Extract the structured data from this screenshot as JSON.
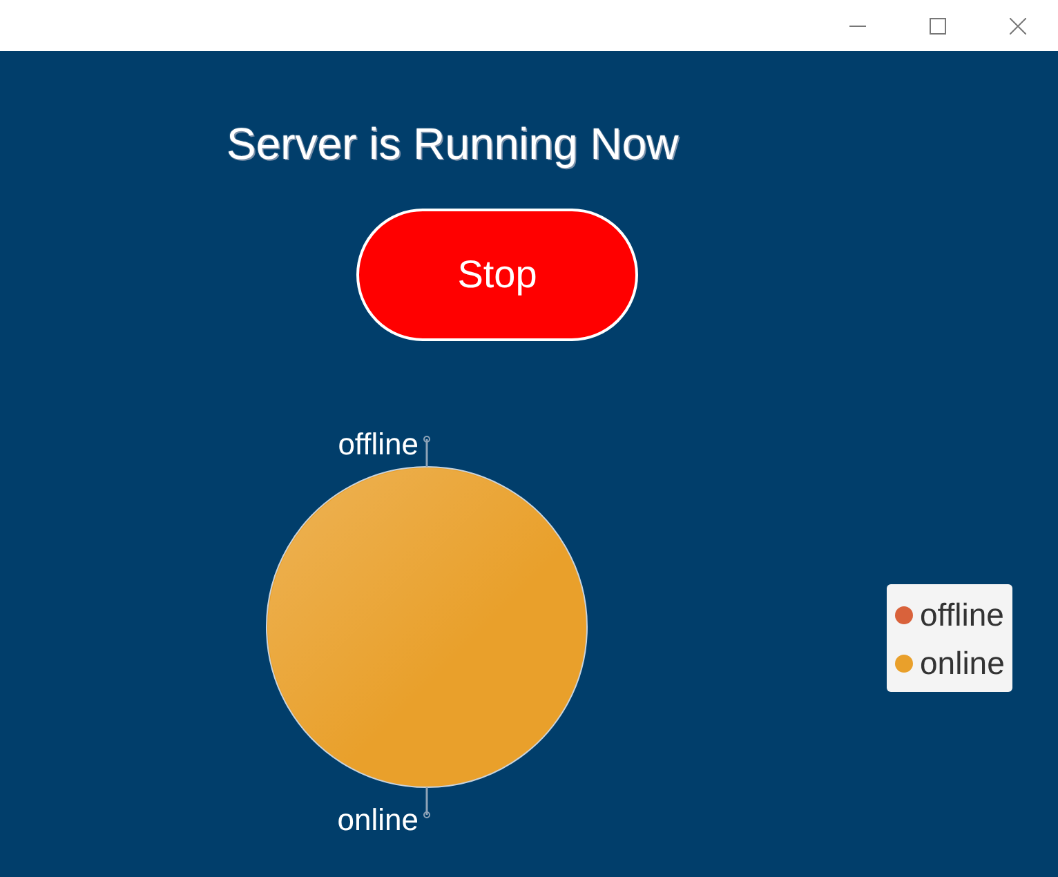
{
  "window": {
    "controls": [
      {
        "kind": "minimize"
      },
      {
        "kind": "maximize"
      },
      {
        "kind": "close"
      }
    ]
  },
  "status": {
    "title": "Server is Running Now",
    "button": "Stop"
  },
  "chart": {
    "chart_data": {
      "type": "pie",
      "categories": [
        "offline",
        "online"
      ],
      "values": [
        0,
        1
      ]
    },
    "legend": [
      {
        "label": "offline",
        "color": "#d9623b"
      },
      {
        "label": "online",
        "color": "#e9a02b"
      }
    ]
  }
}
